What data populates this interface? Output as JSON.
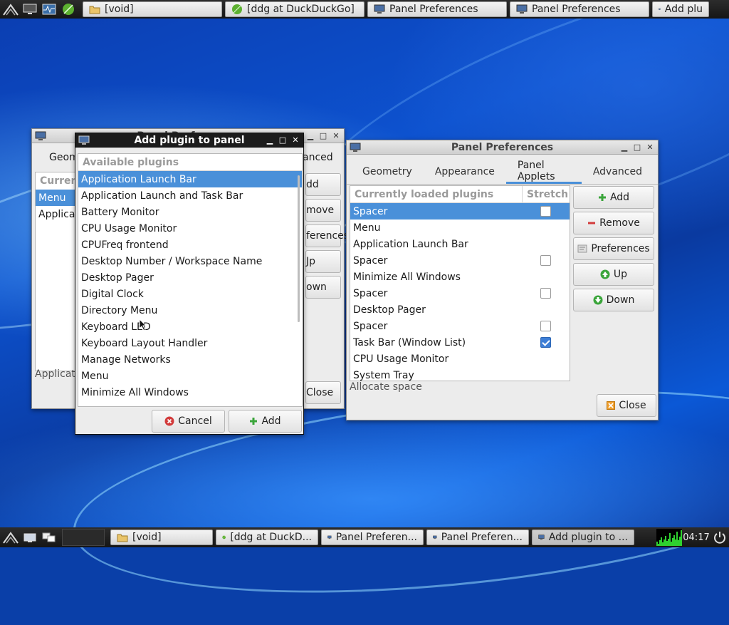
{
  "top_taskbar": {
    "tasks": [
      {
        "label": "[void]",
        "icon": "folder-icon"
      },
      {
        "label": "[ddg at DuckDuckGo]",
        "icon": "leaf-browser-icon"
      },
      {
        "label": "Panel Preferences",
        "icon": "monitor-icon"
      },
      {
        "label": "Panel Preferences",
        "icon": "monitor-icon"
      },
      {
        "label": "Add plu",
        "icon": "monitor-icon"
      }
    ]
  },
  "bottom_taskbar": {
    "tasks": [
      {
        "label": "[void]",
        "icon": "folder-icon"
      },
      {
        "label": "[ddg at DuckD...",
        "icon": "leaf-browser-icon"
      },
      {
        "label": "Panel Preferen...",
        "icon": "monitor-icon"
      },
      {
        "label": "Panel Preferen...",
        "icon": "monitor-icon"
      },
      {
        "label": "Add plugin to ...",
        "icon": "monitor-icon"
      }
    ],
    "clock": "04:17"
  },
  "back_window": {
    "title": "Panel Preferences",
    "tab_partial": "Geom",
    "tab_partial_right": "anced",
    "header_partial": "Curren",
    "rows": [
      "Menu",
      "Applicati"
    ],
    "status_partial": "Applicati",
    "btn_add_partial": "dd",
    "btn_remove_partial": "move",
    "btn_prefs_partial": "ferences",
    "btn_up_partial": "Jp",
    "btn_down_partial": "own",
    "close_partial": "Close"
  },
  "add_dialog": {
    "title": "Add plugin to panel",
    "header": "Available plugins",
    "items": [
      "Application Launch Bar",
      "Application Launch and Task Bar",
      "Battery Monitor",
      "CPU Usage Monitor",
      "CPUFreq frontend",
      "Desktop Number / Workspace Name",
      "Desktop Pager",
      "Digital Clock",
      "Directory Menu",
      "Keyboard LED",
      "Keyboard Layout Handler",
      "Manage Networks",
      "Menu",
      "Minimize All Windows"
    ],
    "selected_index": 0,
    "cancel_label": "Cancel",
    "add_label": "Add"
  },
  "front_window": {
    "title": "Panel Preferences",
    "tabs": [
      "Geometry",
      "Appearance",
      "Panel Applets",
      "Advanced"
    ],
    "active_tab": "Panel Applets",
    "col_plugins": "Currently loaded plugins",
    "col_stretch": "Stretch",
    "rows": [
      {
        "name": "Spacer",
        "stretch": false
      },
      {
        "name": "Menu"
      },
      {
        "name": "Application Launch Bar"
      },
      {
        "name": "Spacer",
        "stretch": false
      },
      {
        "name": "Minimize All Windows"
      },
      {
        "name": "Spacer",
        "stretch": false
      },
      {
        "name": "Desktop Pager"
      },
      {
        "name": "Spacer",
        "stretch": false
      },
      {
        "name": "Task Bar (Window List)",
        "stretch": true
      },
      {
        "name": "CPU Usage Monitor"
      },
      {
        "name": "System Tray"
      }
    ],
    "selected_index": 0,
    "status": "Allocate space",
    "buttons": {
      "add": "Add",
      "remove": "Remove",
      "preferences": "Preferences",
      "up": "Up",
      "down": "Down"
    },
    "close_label": "Close"
  },
  "colors": {
    "selection": "#4a90d9",
    "add_green": "#3aa53a",
    "remove_red": "#d23b3b"
  }
}
